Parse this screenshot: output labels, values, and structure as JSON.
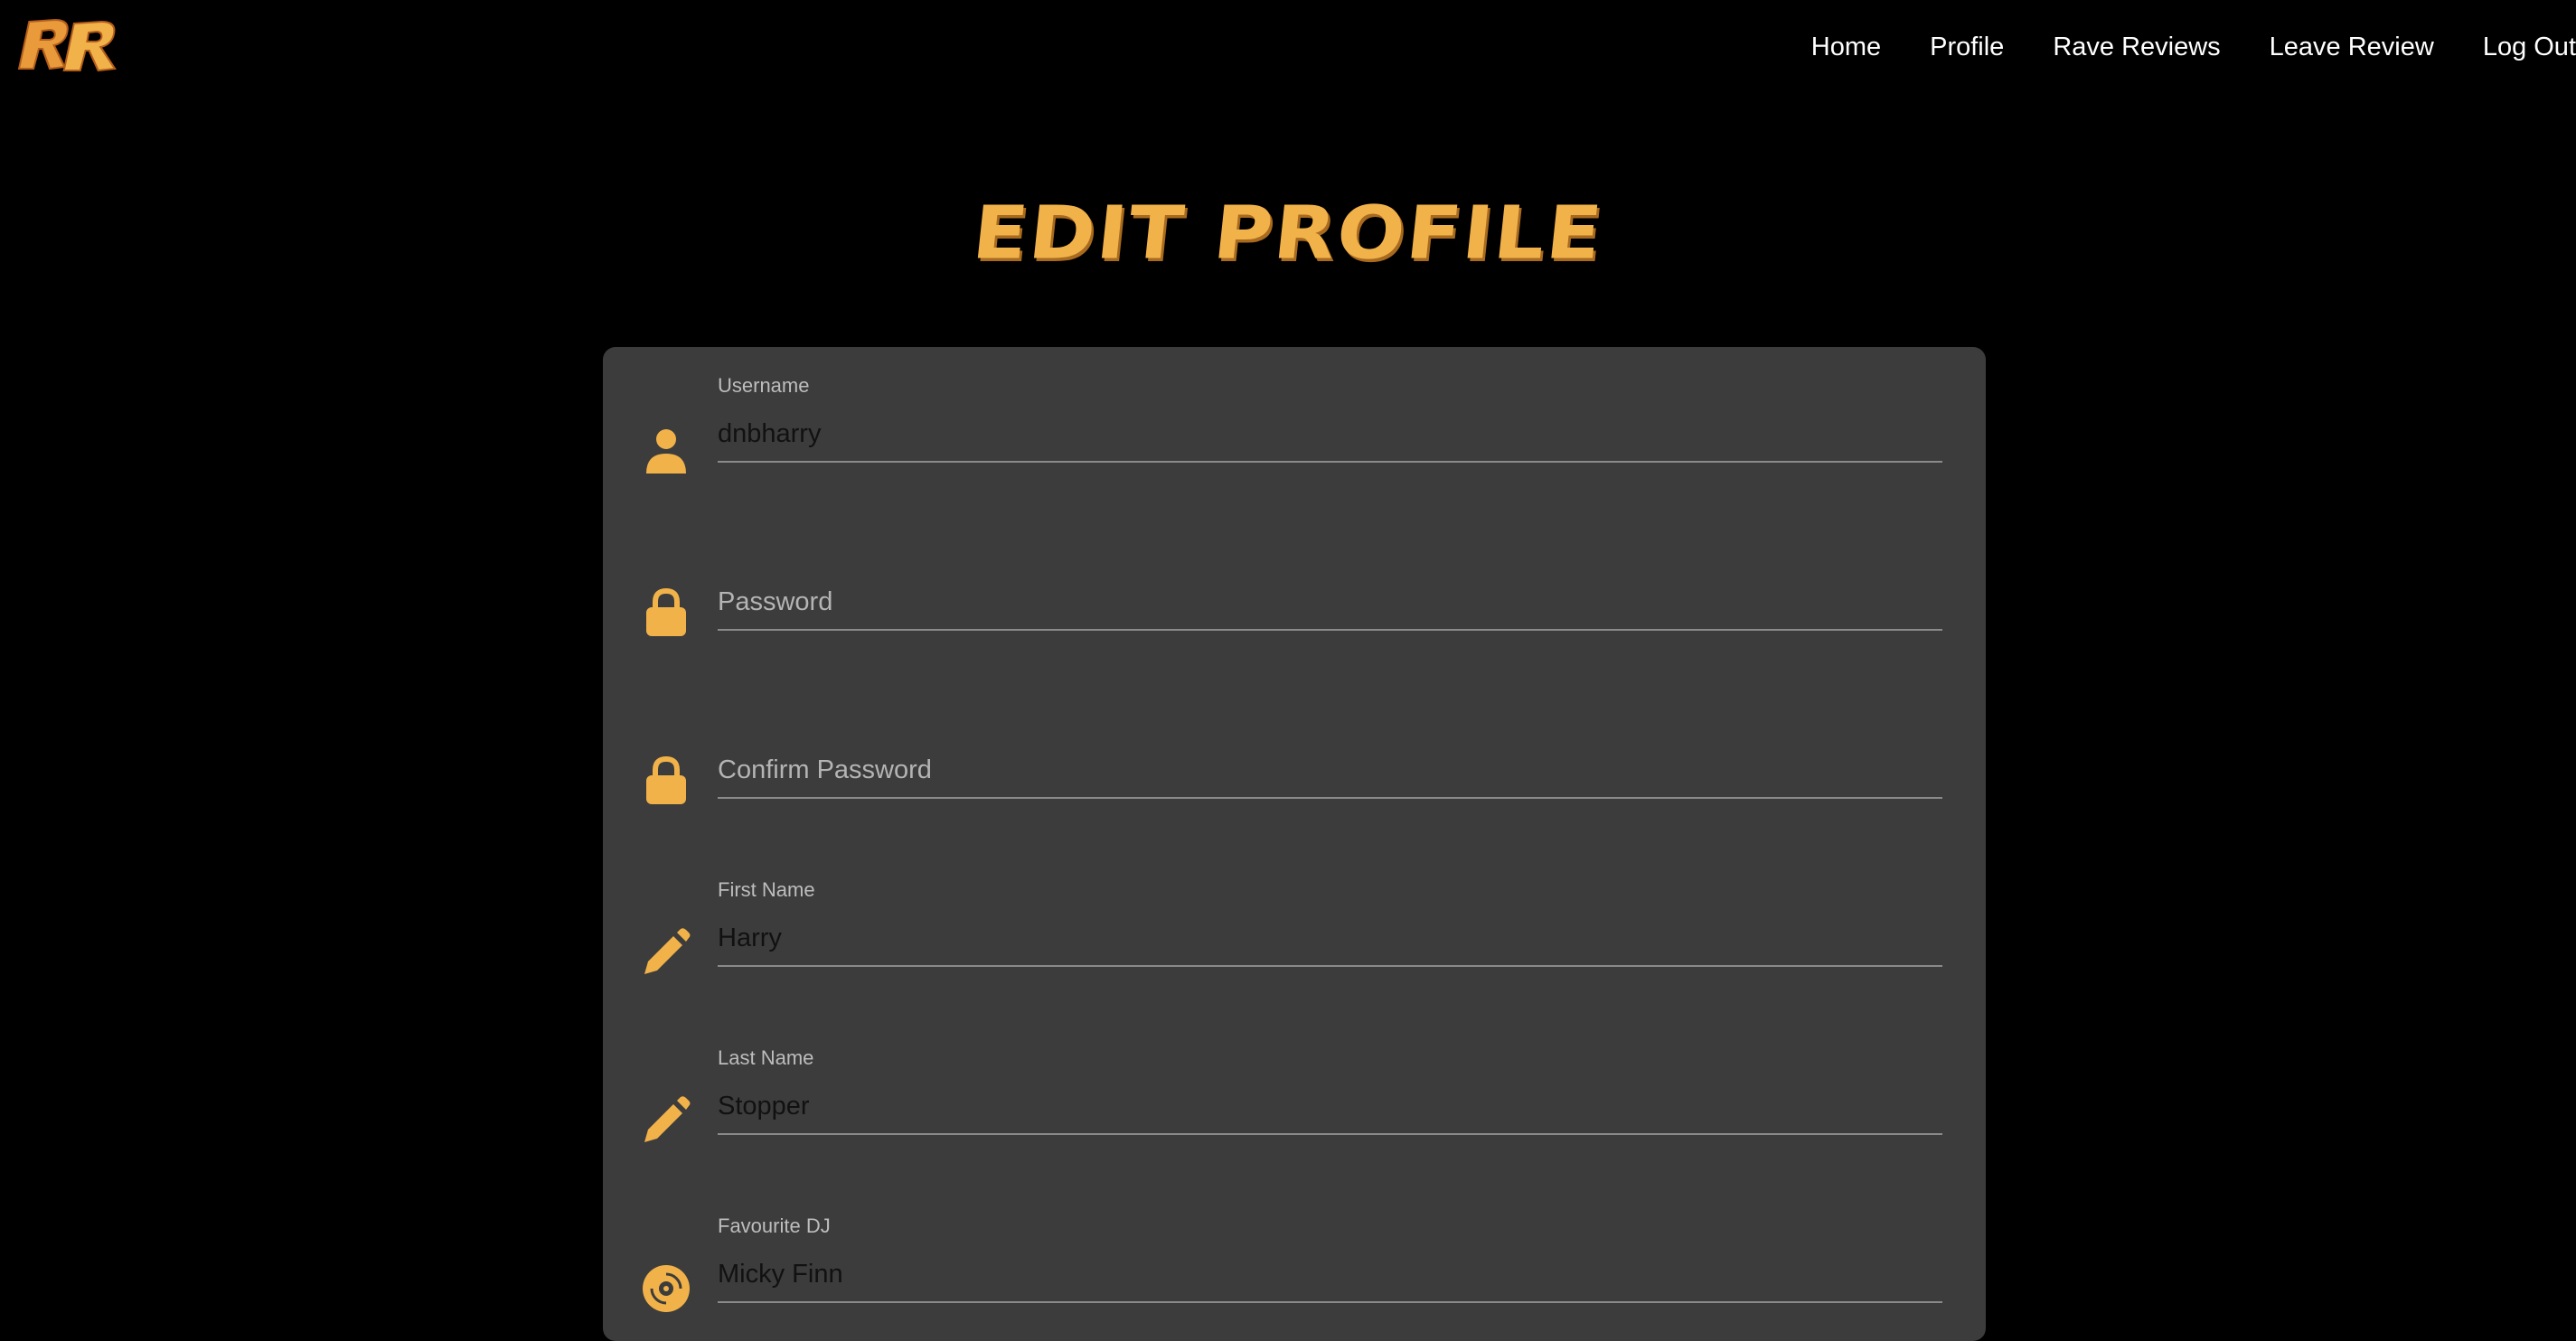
{
  "colors": {
    "accent": "#f2b24a",
    "background": "#000000",
    "card": "#3c3c3c"
  },
  "nav": {
    "logo_text": "RR",
    "links": [
      "Home",
      "Profile",
      "Rave Reviews",
      "Leave Review",
      "Log Out"
    ]
  },
  "page": {
    "title": "EDIT PROFILE"
  },
  "form": {
    "username": {
      "label": "Username",
      "value": "dnbharry",
      "icon": "user-icon"
    },
    "password": {
      "placeholder": "Password",
      "value": "",
      "icon": "lock-icon"
    },
    "confirm_password": {
      "placeholder": "Confirm Password",
      "value": "",
      "icon": "lock-icon"
    },
    "first_name": {
      "label": "First Name",
      "value": "Harry",
      "icon": "pencil-icon"
    },
    "last_name": {
      "label": "Last Name",
      "value": "Stopper",
      "icon": "pencil-icon"
    },
    "favourite_dj": {
      "label": "Favourite DJ",
      "value": "Micky Finn",
      "icon": "vinyl-record-icon"
    }
  }
}
